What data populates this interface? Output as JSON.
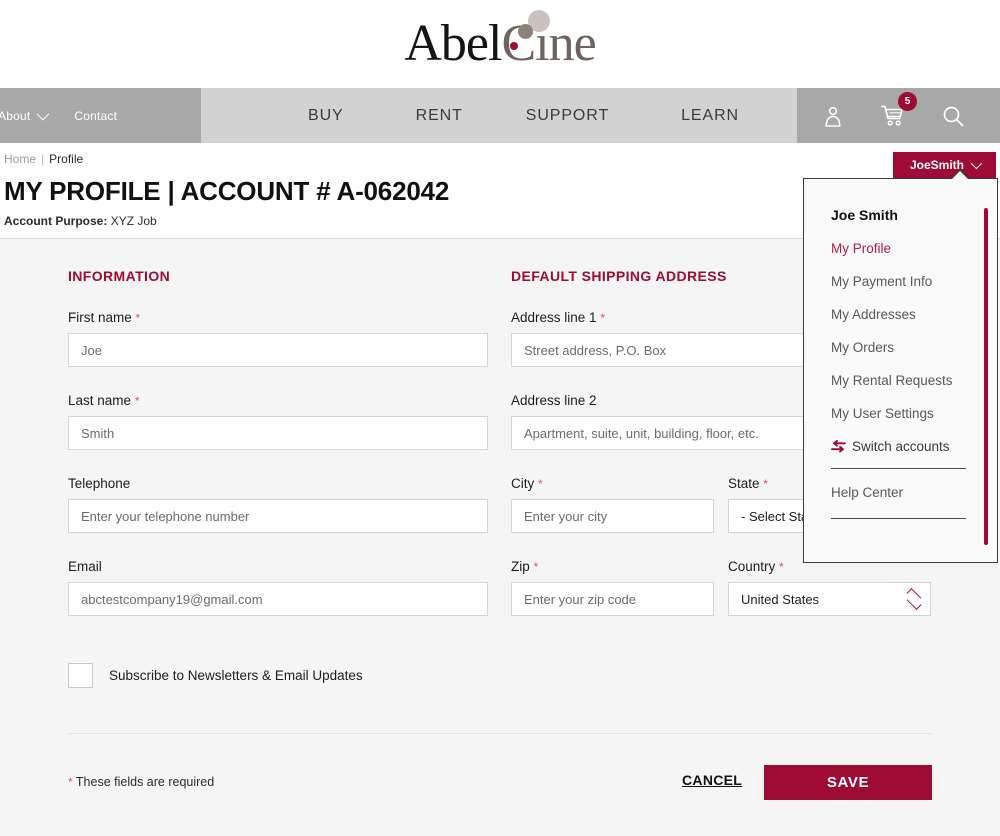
{
  "brand": {
    "logo_abel": "Abel",
    "logo_c": "C",
    "logo_ine": "ine",
    "accent_color": "#9e0b33",
    "nav_left_bg": "#a8a8a8",
    "nav_mid_bg": "#d2d2d2"
  },
  "nav": {
    "left": [
      {
        "label": "About",
        "has_caret": true,
        "icon": "chevron-down-icon"
      },
      {
        "label": "Contact",
        "has_caret": false
      }
    ],
    "main": [
      {
        "label": "BUY"
      },
      {
        "label": "RENT"
      },
      {
        "label": "SUPPORT"
      },
      {
        "label": "LEARN"
      }
    ],
    "right": {
      "account_icon": "user-icon",
      "cart_icon": "cart-icon",
      "cart_count": "5",
      "search_icon": "search-icon"
    }
  },
  "breadcrumb": {
    "home": "Home",
    "separator": "|",
    "current": "Profile"
  },
  "header": {
    "title": "MY PROFILE | ACCOUNT # A-062042",
    "account_purpose_label": "Account Purpose:",
    "account_purpose_value": "XYZ Job"
  },
  "account_button": {
    "label": "JoeSmith",
    "caret_icon": "chevron-down-icon"
  },
  "account_menu": {
    "user_name": "Joe Smith",
    "items": [
      {
        "label": "My Profile",
        "active": true
      },
      {
        "label": "My Payment Info",
        "active": false
      },
      {
        "label": "My Addresses",
        "active": false
      },
      {
        "label": "My Orders",
        "active": false
      },
      {
        "label": "My Rental Requests",
        "active": false
      },
      {
        "label": "My User Settings",
        "active": false
      }
    ],
    "switch_accounts": "Switch accounts",
    "switch_icon": "swap-arrows-icon",
    "help_center": "Help Center",
    "scrollbar": "vertical-scrollbar"
  },
  "information": {
    "heading": "INFORMATION",
    "first_name": {
      "label": "First name",
      "required": "*",
      "value": "Joe"
    },
    "last_name": {
      "label": "Last name",
      "required": "*",
      "value": "Smith"
    },
    "telephone": {
      "label": "Telephone",
      "required": "",
      "value": "",
      "placeholder": "Enter your telephone number"
    },
    "email": {
      "label": "Email",
      "required": "",
      "value": "abctestcompany19@gmail.com"
    }
  },
  "shipping": {
    "heading": "DEFAULT SHIPPING ADDRESS",
    "address1": {
      "label": "Address line 1",
      "required": "*",
      "value": "",
      "placeholder": "Street address, P.O. Box"
    },
    "address2": {
      "label": "Address line 2",
      "required": "",
      "value": "",
      "placeholder": "Apartment, suite, unit, building, floor, etc."
    },
    "city": {
      "label": "City",
      "required": "*",
      "value": "",
      "placeholder": "Enter your city"
    },
    "state": {
      "label": "State",
      "required": "*",
      "selected": "- Select State -"
    },
    "zip": {
      "label": "Zip",
      "required": "*",
      "value": "",
      "placeholder": "Enter your zip code"
    },
    "country": {
      "label": "Country",
      "required": "*",
      "selected": "United States"
    }
  },
  "newsletter": {
    "label": "Subscribe to Newsletters & Email Updates",
    "checked": false
  },
  "footer": {
    "required_marker": "*",
    "required_note": "These fields are required",
    "cancel_label": "CANCEL",
    "save_label": "SAVE"
  }
}
